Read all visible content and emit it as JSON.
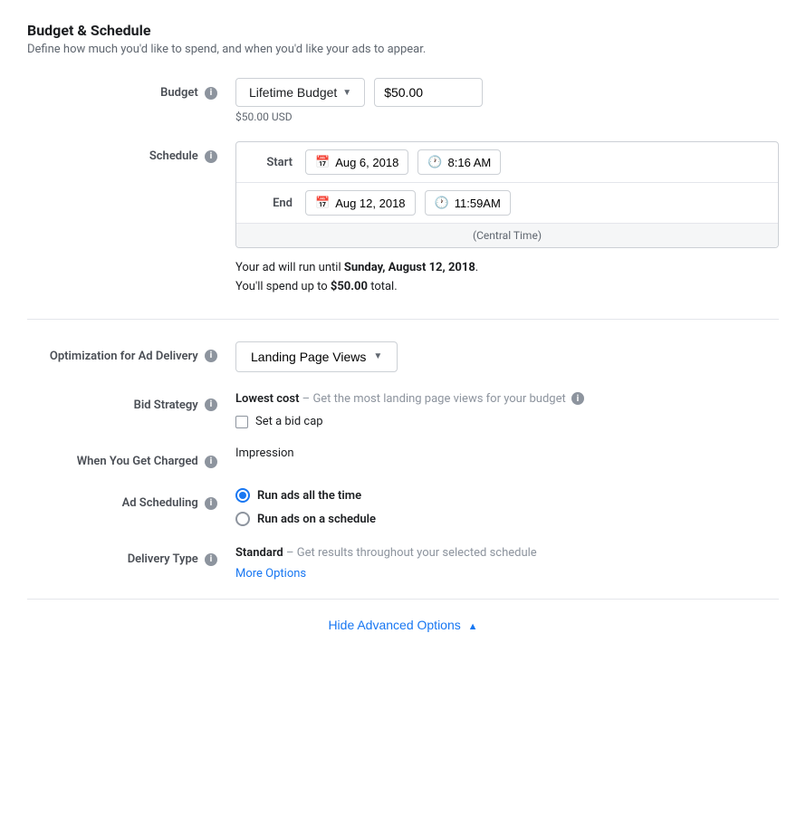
{
  "page": {
    "title": "Budget & Schedule",
    "subtitle": "Define how much you'd like to spend, and when you'd like your ads to appear."
  },
  "budget": {
    "label": "Budget",
    "type_label": "Lifetime Budget",
    "amount": "$50.00",
    "amount_usd": "$50.00 USD"
  },
  "schedule": {
    "label": "Schedule",
    "start_label": "Start",
    "start_date": "Aug 6, 2018",
    "start_time": "8:16 AM",
    "end_label": "End",
    "end_date": "Aug 12, 2018",
    "end_time": "11:59AM",
    "timezone": "(Central Time)"
  },
  "ad_run_note_1": "Your ad will run until ",
  "ad_run_note_bold": "Sunday, August 12, 2018",
  "ad_run_note_1_end": ".",
  "ad_run_note_2": "You'll spend up to ",
  "ad_run_note_2_bold": "$50.00",
  "ad_run_note_2_end": " total.",
  "optimization": {
    "label": "Optimization for Ad Delivery",
    "value": "Landing Page Views"
  },
  "bid_strategy": {
    "label": "Bid Strategy",
    "name": "Lowest cost",
    "separator": " – ",
    "description": "Get the most landing page views for your budget",
    "set_bid_cap": "Set a bid cap"
  },
  "charged": {
    "label": "When You Get Charged",
    "value": "Impression"
  },
  "ad_scheduling": {
    "label": "Ad Scheduling",
    "option1": "Run ads all the time",
    "option2": "Run ads on a schedule",
    "selected": "option1"
  },
  "delivery_type": {
    "label": "Delivery Type",
    "name": "Standard",
    "separator": " – ",
    "description": "Get results throughout your selected schedule",
    "more_options": "More Options"
  },
  "hide_advanced": "Hide Advanced Options",
  "icons": {
    "info": "i",
    "calendar": "📅",
    "clock": "🕐",
    "dropdown_arrow": "▼",
    "up_arrow": "▲"
  }
}
